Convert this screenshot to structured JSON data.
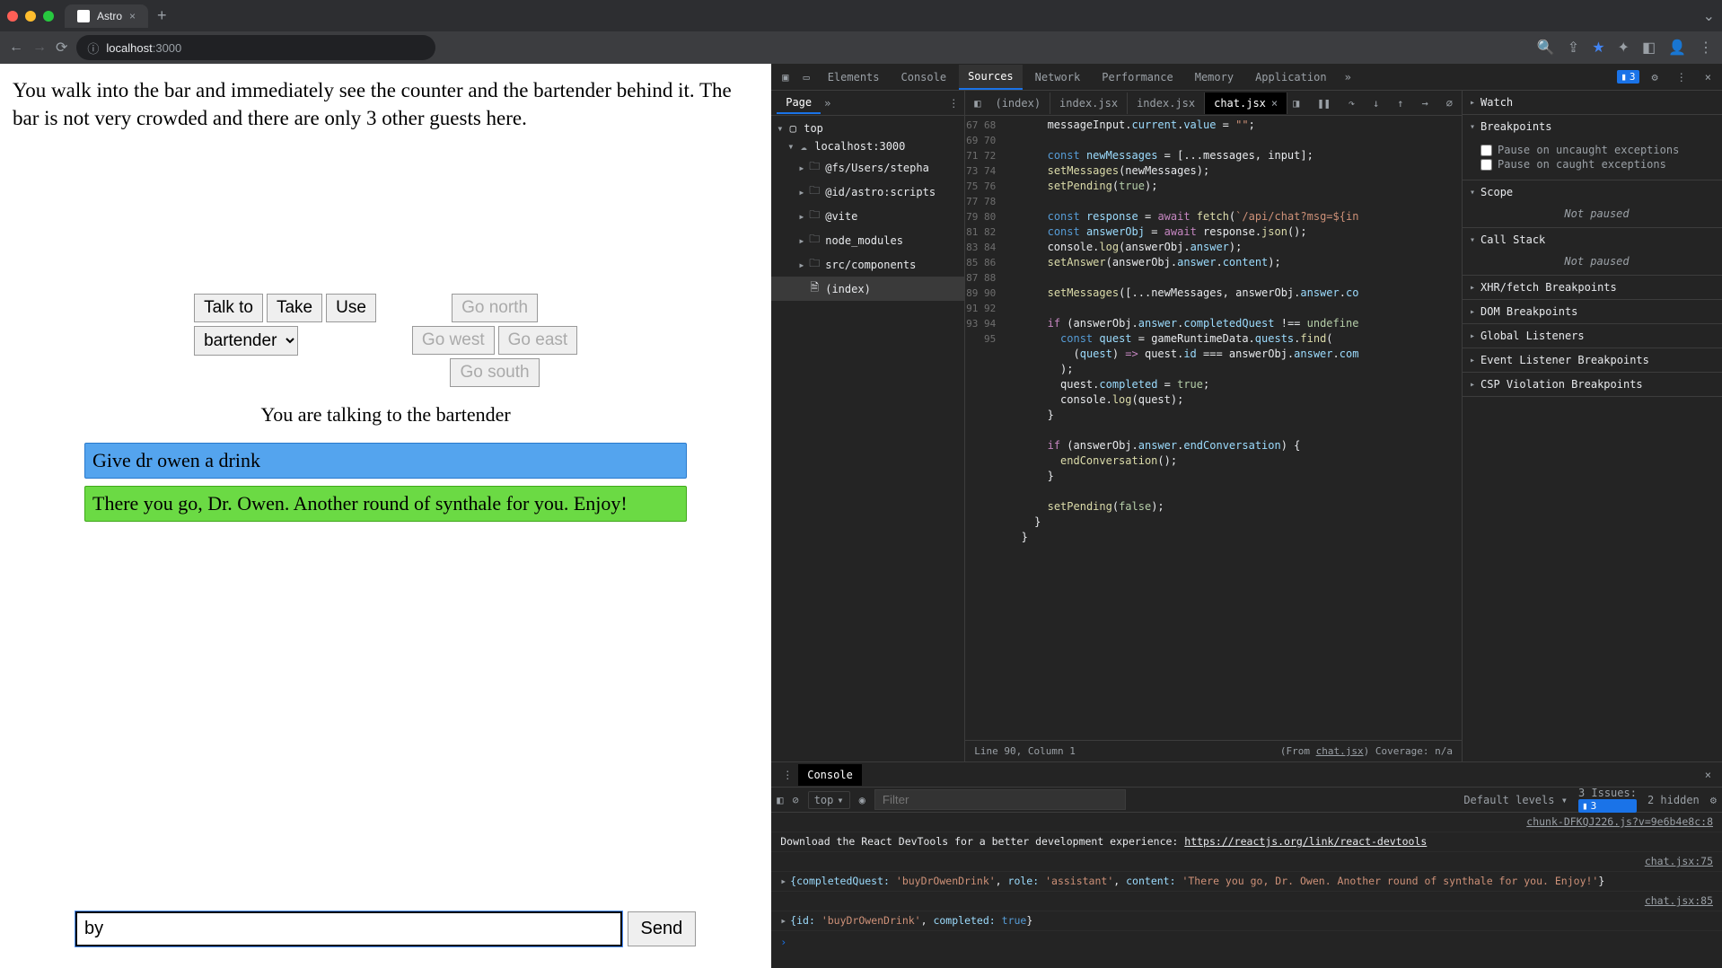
{
  "browser": {
    "tab_title": "Astro",
    "url_host": "localhost",
    "url_port": ":3000"
  },
  "game": {
    "narration": "You walk into the bar and immediately see the counter and the bartender behind it. The bar is not very crowded and there are only 3 other guests here.",
    "buttons": {
      "talk": "Talk to",
      "take": "Take",
      "use": "Use",
      "north": "Go north",
      "west": "Go west",
      "east": "Go east",
      "south": "Go south",
      "send": "Send"
    },
    "target_select": "bartender",
    "talk_status": "You are talking to the bartender",
    "user_msg": "Give dr owen a drink",
    "reply_msg": "There you go, Dr. Owen. Another round of synthale for you. Enjoy!",
    "input_value": "by"
  },
  "devtools": {
    "tabs": {
      "elements": "Elements",
      "console": "Console",
      "sources": "Sources",
      "network": "Network",
      "performance": "Performance",
      "memory": "Memory",
      "application": "Application"
    },
    "issue_count": "3",
    "sources": {
      "page_tab": "Page",
      "tree": {
        "top": "top",
        "host": "localhost:3000",
        "fs": "@fs/Users/stepha",
        "astro": "@id/astro:scripts",
        "vite": "@vite",
        "node": "node_modules",
        "components": "src/components",
        "index": "(index)"
      },
      "editor_tabs": {
        "idx": "(index)",
        "idxjsx1": "index.jsx",
        "idxjsx2": "index.jsx",
        "chat": "chat.jsx"
      },
      "status_left": "Line 90, Column 1",
      "status_right_prefix": "(From ",
      "status_right_file": "chat.jsx",
      "status_right_suffix": ")  Coverage: n/a"
    },
    "debug": {
      "watch": "Watch",
      "breakpoints": "Breakpoints",
      "pause_uncaught": "Pause on uncaught exceptions",
      "pause_caught": "Pause on caught exceptions",
      "scope": "Scope",
      "not_paused": "Not paused",
      "callstack": "Call Stack",
      "xhr": "XHR/fetch Breakpoints",
      "dom": "DOM Breakpoints",
      "global": "Global Listeners",
      "event": "Event Listener Breakpoints",
      "csp": "CSP Violation Breakpoints"
    },
    "gutter": [
      "67",
      "68",
      "69",
      "70",
      "71",
      "72",
      "73",
      "74",
      "75",
      "76",
      "77",
      "78",
      "79",
      "80",
      "81",
      "82",
      "83",
      "84",
      "85",
      "86",
      "87",
      "88",
      "89",
      "90",
      "91",
      "92",
      "93",
      "94",
      "95"
    ],
    "console": {
      "tab": "Console",
      "context": "top",
      "filter_ph": "Filter",
      "levels": "Default levels",
      "issues_label": "3 Issues:",
      "issues_count": "3",
      "hidden": "2 hidden",
      "log0_src": "chunk-DFKQJ226.js?v=9e6b4e8c:8",
      "log0": "Download the React DevTools for a better development experience: ",
      "log0_link": "https://reactjs.org/link/react-devtools",
      "log1_src": "chat.jsx:75",
      "log1": "{completedQuest: 'buyDrOwenDrink', role: 'assistant', content: 'There you go, Dr. Owen. Another round of synthale for you. Enjoy!'}",
      "log2_src": "chat.jsx:85",
      "log2": "{id: 'buyDrOwenDrink', completed: true}"
    }
  }
}
